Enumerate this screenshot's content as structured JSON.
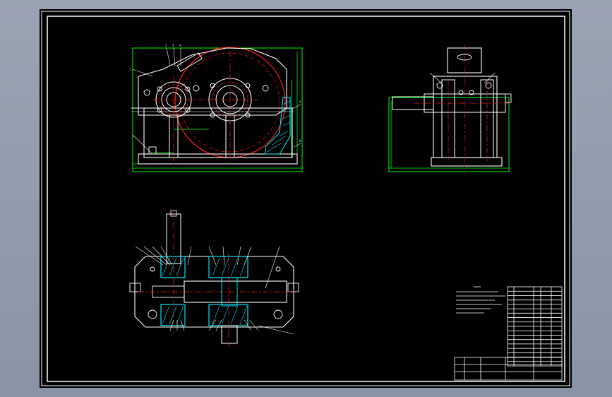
{
  "colors": {
    "background": "#8f99ab",
    "sheet": "#000000",
    "outline": "#ffffff",
    "dimension": "#00ff00",
    "centerline": "#ff2020",
    "hatch": "#00e5ff",
    "note": "#ffffff"
  },
  "views": [
    "front-view",
    "side-view",
    "top-view"
  ],
  "title_block": {
    "rows": 18,
    "note_lines": 6
  }
}
